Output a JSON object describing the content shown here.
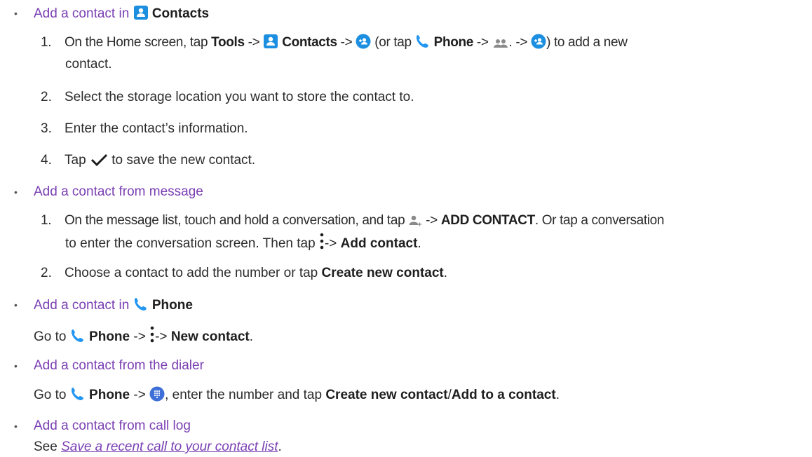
{
  "sections": {
    "contacts": {
      "heading_prefix": "Add a contact in",
      "heading_app": "Contacts",
      "steps": {
        "s1": {
          "num": "1.",
          "pre": "On the Home screen, tap",
          "tools": "Tools",
          "arrow1": "->",
          "contacts": "Contacts",
          "arrow2": "->",
          "or_tap": "(or tap",
          "phone": "Phone",
          "arrow3": "->",
          "arrow4": ". ->",
          "tail": ") to add a new",
          "cont": "contact."
        },
        "s2": {
          "num": "2.",
          "text": "Select the storage location you want to store the contact to."
        },
        "s3": {
          "num": "3.",
          "text": "Enter the contact’s information."
        },
        "s4": {
          "num": "4.",
          "pre": "Tap",
          "post": "to save the new contact."
        }
      }
    },
    "message": {
      "heading": "Add a contact from message",
      "steps": {
        "s1": {
          "num": "1.",
          "pre": "On the message list, touch and hold a conversation, and tap",
          "arrow1": "->",
          "add_contact_caps": "ADD CONTACT",
          "mid": ". Or tap a conversation",
          "line2_pre": "to enter the conversation screen. Then tap",
          "arrow2": "->",
          "add_contact": "Add contact",
          "end": "."
        },
        "s2": {
          "num": "2.",
          "pre": "Choose a contact to add the number or tap",
          "create": "Create new contact",
          "end": "."
        }
      }
    },
    "phone": {
      "heading_prefix": "Add a contact in",
      "heading_app": "Phone",
      "go_to": "Go to",
      "phone": "Phone",
      "arrow1": "->",
      "arrow2": "->",
      "new_contact": "New contact",
      "end": "."
    },
    "dialer": {
      "heading": "Add a contact from the dialer",
      "go_to": "Go to",
      "phone": "Phone",
      "arrow": "->",
      "mid": ", enter the number and tap",
      "create": "Create new contact",
      "slash": "/",
      "add_to": "Add to a contact",
      "end": "."
    },
    "calllog": {
      "heading": "Add a contact from call log",
      "see": "See",
      "link": "Save a recent call to your contact list",
      "end": "."
    }
  },
  "colors": {
    "heading": "#7a3fb3",
    "icon_blue": "#1d8fe1",
    "phone_blue": "#2196f3",
    "text": "#2b2b2b"
  },
  "icons": [
    "contacts-app-icon",
    "add-contact-icon",
    "phone-app-icon",
    "people-icon",
    "checkmark-icon",
    "add-person-icon",
    "overflow-menu-icon",
    "dialpad-icon"
  ]
}
